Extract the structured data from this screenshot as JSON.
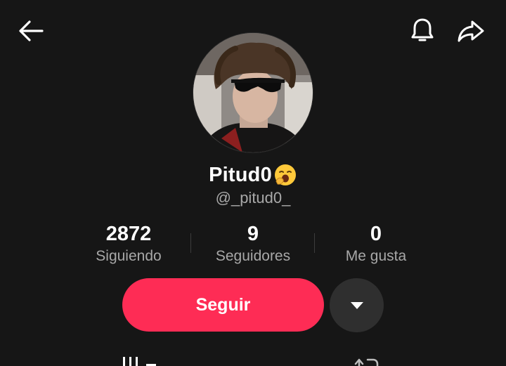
{
  "header": {
    "back_icon": "arrow-left-icon",
    "notification_icon": "bell-icon",
    "share_icon": "share-arrow-icon"
  },
  "profile": {
    "display_name": "Pitud0",
    "name_emoji": "yawning-face-emoji",
    "username": "@_pitud0_"
  },
  "stats": {
    "following": {
      "value": "2872",
      "label": "Siguiendo"
    },
    "followers": {
      "value": "9",
      "label": "Seguidores"
    },
    "likes": {
      "value": "0",
      "label": "Me gusta"
    }
  },
  "actions": {
    "follow_label": "Seguir",
    "more_icon": "caret-down-icon"
  },
  "tabs": [
    {
      "icon": "videos-grid-icon"
    },
    {
      "icon": "repost-icon"
    }
  ],
  "colors": {
    "background": "#161616",
    "accent": "#fe2c55",
    "secondary_button": "#2f2f2f",
    "muted_text": "#a8a8a8"
  }
}
